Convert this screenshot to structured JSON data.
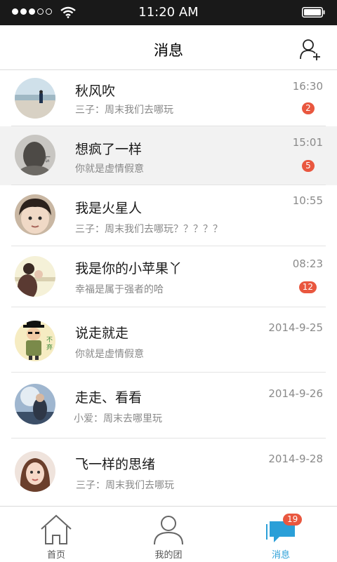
{
  "status_bar": {
    "time": "11:20 AM",
    "signal_bars_filled": 3,
    "signal_bars_total": 5
  },
  "header": {
    "title": "消息",
    "add_friend_icon": "add-user-icon"
  },
  "conversations": [
    {
      "name": "秋风吹",
      "preview": "三子：周末我们去哪玩",
      "time": "16:30",
      "unread": "2",
      "avatar": "beach-photo"
    },
    {
      "name": "想疯了一样",
      "preview": "你就是虚情假意",
      "time": "15:01",
      "unread": "5",
      "avatar": "girl-back-photo"
    },
    {
      "name": "我是火星人",
      "preview": "三子：周末我们去哪玩？？？？？",
      "time": "10:55",
      "unread": "",
      "avatar": "child-photo"
    },
    {
      "name": "我是你的小苹果丫",
      "preview": "幸福是属于强者的哈",
      "time": "08:23",
      "unread": "12",
      "avatar": "couple-photo"
    },
    {
      "name": "说走就走",
      "preview": "你就是虚情假意",
      "time": "2014-9-25",
      "unread": "",
      "avatar": "cartoon-hat-man"
    },
    {
      "name": "走走、看看",
      "preview": "小爱：周末去哪里玩",
      "time": "2014-9-26",
      "unread": "",
      "avatar": "sky-girl-photo"
    },
    {
      "name": "飞一样的思绪",
      "preview": "三子：周末我们去哪玩",
      "time": "2014-9-28",
      "unread": "",
      "avatar": "girl-portrait-photo"
    }
  ],
  "tabs": [
    {
      "label": "首页",
      "icon": "home-icon",
      "active": false
    },
    {
      "label": "我的团",
      "icon": "user-icon",
      "active": false
    },
    {
      "label": "消息",
      "icon": "message-icon",
      "active": true,
      "badge": "19"
    }
  ],
  "colors": {
    "badge": "#e9573f",
    "active_tab": "#2a9fd8",
    "status_bar": "#191919",
    "selected_row": "#f2f2f2"
  }
}
